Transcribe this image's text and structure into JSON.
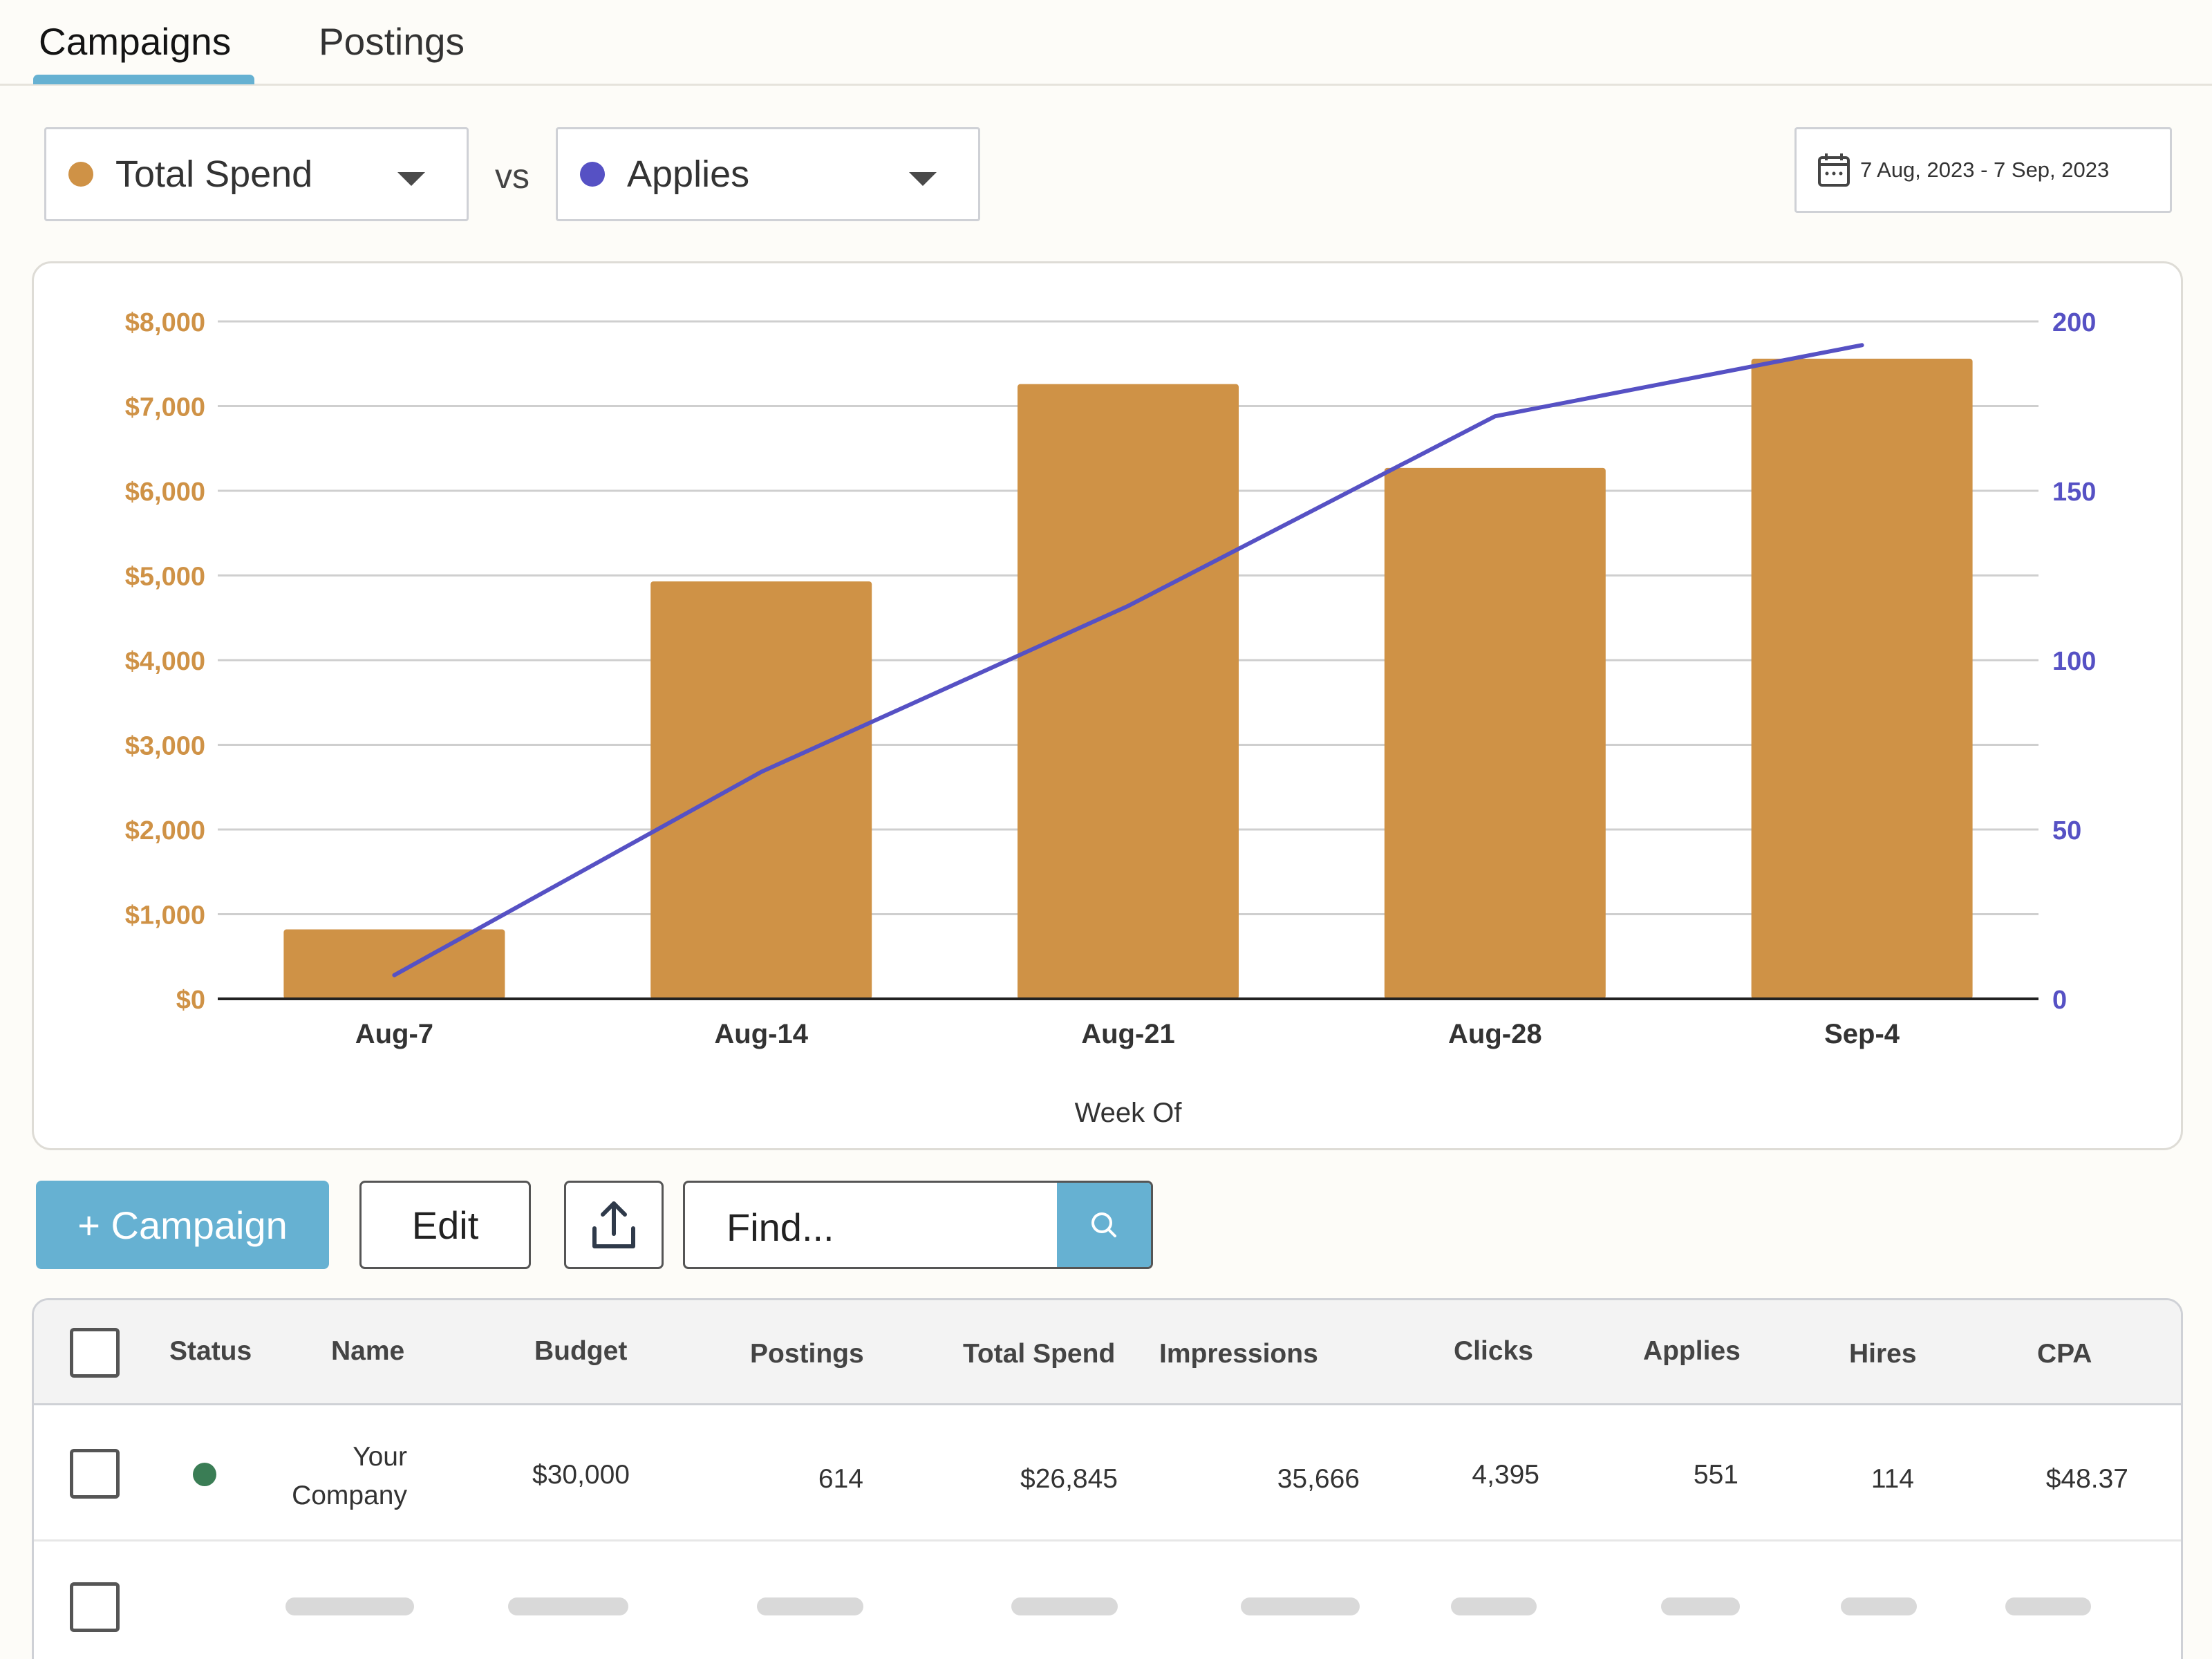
{
  "tabs": [
    "Campaigns",
    "Postings"
  ],
  "metric_selectors": {
    "primary": {
      "label": "Total Spend",
      "color": "#cf9246"
    },
    "vs_label": "vs",
    "secondary": {
      "label": "Applies",
      "color": "#5651c4"
    }
  },
  "date_range": "7 Aug, 2023 - 7 Sep, 2023",
  "toolbar": {
    "add_campaign": "+ Campaign",
    "edit": "Edit",
    "find_placeholder": "Find..."
  },
  "table": {
    "headers": [
      "Status",
      "Name",
      "Budget",
      "Postings",
      "Total Spend",
      "Impressions",
      "Clicks",
      "Applies",
      "Hires",
      "CPA"
    ],
    "rows": [
      {
        "status_color": "#3a7d55",
        "name_line1": "Your",
        "name_line2": "Company",
        "budget": "$30,000",
        "postings": "614",
        "total_spend": "$26,845",
        "impressions": "35,666",
        "clicks": "4,395",
        "applies": "551",
        "hires": "114",
        "cpa": "$48.37"
      }
    ]
  },
  "chart_data": {
    "type": "bar",
    "categories": [
      "Aug-7",
      "Aug-14",
      "Aug-21",
      "Aug-28",
      "Sep-4"
    ],
    "xlabel": "Week Of",
    "series": [
      {
        "name": "Total Spend",
        "type": "bar",
        "axis": "left",
        "color": "#cf9246",
        "values": [
          820,
          4930,
          7260,
          6270,
          7560
        ]
      },
      {
        "name": "Applies",
        "type": "line",
        "axis": "right",
        "color": "#5651c4",
        "values": [
          7,
          67,
          116,
          172,
          193
        ]
      }
    ],
    "y_left": {
      "range": [
        0,
        8000
      ],
      "ticks": [
        "$0",
        "$1,000",
        "$2,000",
        "$3,000",
        "$4,000",
        "$5,000",
        "$6,000",
        "$7,000",
        "$8,000"
      ],
      "color": "#cf9246"
    },
    "y_right": {
      "range": [
        0,
        200
      ],
      "ticks": [
        "0",
        "50",
        "100",
        "150",
        "200"
      ],
      "color": "#5651c4"
    },
    "grid": true
  }
}
